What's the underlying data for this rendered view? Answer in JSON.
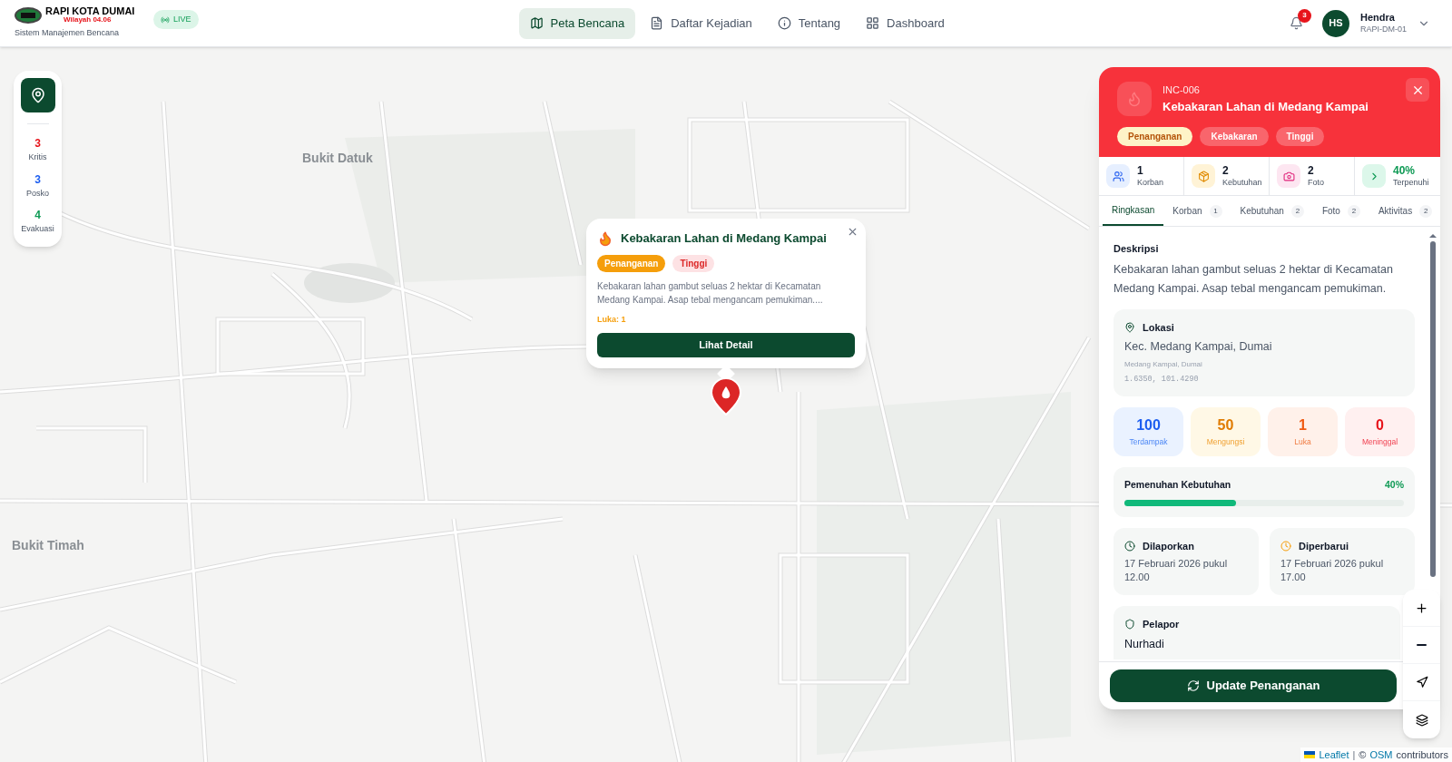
{
  "header": {
    "logo_title": "RAPI KOTA DUMAI",
    "logo_subtitle": "Wilayah 04.06",
    "tagline": "Sistem Manajemen Bencana",
    "live_label": "LIVE",
    "nav": [
      {
        "label": "Peta Bencana",
        "selected": true
      },
      {
        "label": "Daftar Kejadian",
        "selected": false
      },
      {
        "label": "Tentang",
        "selected": false
      },
      {
        "label": "Dashboard",
        "selected": false
      }
    ],
    "notification_count": "3",
    "user": {
      "initials": "HS",
      "name": "Hendra",
      "id": "RAPI-DM-01"
    }
  },
  "map": {
    "labels": [
      {
        "text": "Bukit Datuk",
        "kind": "area"
      },
      {
        "text": "Bukit Timah",
        "kind": "area"
      }
    ]
  },
  "stats_card": {
    "items": [
      {
        "value": "3",
        "label": "Kritis",
        "color": "#e7141b"
      },
      {
        "value": "3",
        "label": "Posko",
        "color": "#1d5ef0"
      },
      {
        "value": "4",
        "label": "Evakuasi",
        "color": "#0f9a55"
      }
    ]
  },
  "popup": {
    "title": "Kebakaran Lahan di Medang Kampai",
    "tags": [
      {
        "label": "Penanganan",
        "kind": "status"
      },
      {
        "label": "Tinggi",
        "kind": "severity"
      }
    ],
    "description": "Kebakaran lahan gambut seluas 2 hektar di Kecamatan Medang Kampai. Asap tebal mengancam pemukiman....",
    "injury": "Luka: 1",
    "button": "Lihat Detail"
  },
  "panel": {
    "id": "INC-006",
    "title": "Kebakaran Lahan di Medang Kampai",
    "tags": [
      {
        "label": "Penanganan",
        "kind": "status"
      },
      {
        "label": "Kebakaran",
        "kind": "plain"
      },
      {
        "label": "Tinggi",
        "kind": "plain"
      }
    ],
    "summary": [
      {
        "value": "1",
        "label": "Korban",
        "kind": "people"
      },
      {
        "value": "2",
        "label": "Kebutuhan",
        "kind": "package"
      },
      {
        "value": "2",
        "label": "Foto",
        "kind": "photo"
      },
      {
        "value": "40%",
        "label": "Terpenuhi",
        "kind": "progress"
      }
    ],
    "tabs": [
      {
        "label": "Ringkasan",
        "selected": true
      },
      {
        "label": "Korban",
        "count": "1",
        "selected": false
      },
      {
        "label": "Kebutuhan",
        "count": "2",
        "selected": false
      },
      {
        "label": "Foto",
        "count": "2",
        "selected": false
      },
      {
        "label": "Aktivitas",
        "count": "2",
        "selected": false
      }
    ],
    "description_heading": "Deskripsi",
    "description": "Kebakaran lahan gambut seluas 2 hektar di Kecamatan Medang Kampai. Asap tebal mengancam pemukiman.",
    "location": {
      "heading": "Lokasi",
      "address": "Kec. Medang Kampai, Dumai",
      "area": "Medang Kampai, Dumai",
      "coords": "1.6350, 101.4290"
    },
    "casualties": [
      {
        "value": "100",
        "label": "Terdampak",
        "kind": "affected"
      },
      {
        "value": "50",
        "label": "Mengungsi",
        "kind": "displaced"
      },
      {
        "value": "1",
        "label": "Luka",
        "kind": "injured"
      },
      {
        "value": "0",
        "label": "Meninggal",
        "kind": "dead"
      }
    ],
    "fulfillment": {
      "label": "Pemenuhan Kebutuhan",
      "reading": "40%",
      "level": 0.4
    },
    "times": [
      {
        "heading": "Dilaporkan",
        "text": "17 Februari 2026 pukul 12.00",
        "kind": "reported"
      },
      {
        "heading": "Diperbarui",
        "text": "17 Februari 2026 pukul 17.00",
        "kind": "updated"
      }
    ],
    "reporter": {
      "heading": "Pelapor",
      "name": "Nurhadi"
    },
    "action": "Update Penanganan"
  },
  "attribution": {
    "leaflet": "Leaflet",
    "separator": "|",
    "copyright": "©",
    "osm": "OSM",
    "suffix": "contributors"
  }
}
